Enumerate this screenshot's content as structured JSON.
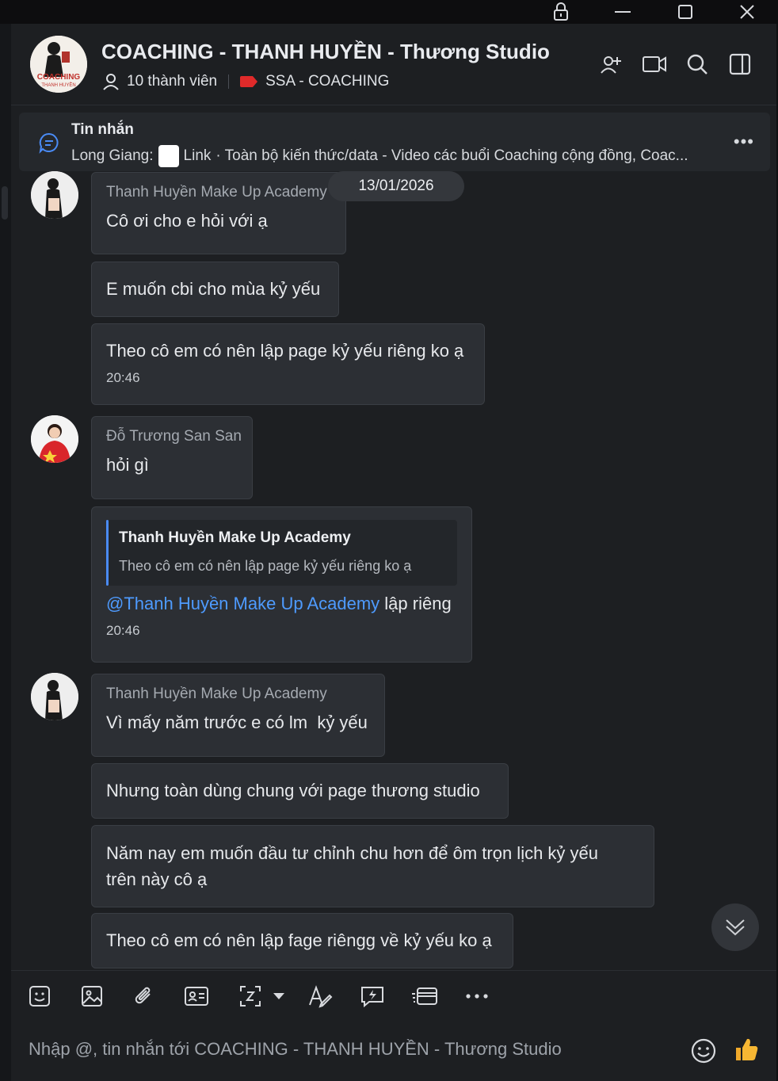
{
  "window": {
    "lock_icon": "lock-icon",
    "minimize_icon": "minimize-icon",
    "maximize_icon": "maximize-icon",
    "close_icon": "close-icon"
  },
  "header": {
    "title": "COACHING - THANH HUYỀN - Thương Studio",
    "members_label": "10 thành viên",
    "tag_label": "SSA - COACHING",
    "tag_color": "#e02a2a",
    "avatar_badge_text": "COACHING",
    "avatar_badge_sub": "THANH HUYỀN",
    "actions": [
      "add-member-icon",
      "video-call-icon",
      "search-icon",
      "sidebar-toggle-icon"
    ]
  },
  "pinned": {
    "title": "Tin nhắn",
    "sender": "Long Giang:",
    "link_label": "Link",
    "text": "· Toàn bộ kiến thức/data - Video các buổi Coaching cộng đồng, Coac..."
  },
  "date_chip": "13/01/2026",
  "messages": [
    {
      "sender": "Thanh Huyền Make Up Academy",
      "text": "Cô ơi cho e hỏi với ạ"
    },
    {
      "text": "E muốn cbi cho mùa kỷ yếu"
    },
    {
      "text": "Theo cô em có nên lập page kỷ yếu riêng ko ạ",
      "time": "20:46"
    },
    {
      "sender": "Đỗ Trương San San",
      "text": "hỏi gì"
    },
    {
      "quote_name": "Thanh Huyền Make Up Academy",
      "quote_text": "Theo cô em có nên lập page kỷ yếu riêng ko ạ",
      "mention": "@Thanh Huyền Make Up Academy",
      "text": " lập riêng",
      "time": "20:46"
    },
    {
      "sender": "Thanh Huyền Make Up Academy",
      "text": "Vì mấy năm trước e có lm  kỷ yếu"
    },
    {
      "text": "Nhưng toàn dùng chung với page thương studio"
    },
    {
      "text_line1": "Năm nay em muốn đầu tư chỉnh chu hơn để ôm trọn lịch kỷ yếu",
      "text_line2": "trên này cô ạ"
    },
    {
      "text": "Theo cô em có nên lập fage riêngg về kỷ yếu ko ạ"
    }
  ],
  "toolbar": [
    "sticker-icon",
    "image-icon",
    "attachment-icon",
    "contact-card-icon",
    "screenshot-icon",
    "format-text-icon",
    "quick-message-icon",
    "card-icon",
    "more-icon"
  ],
  "composer": {
    "placeholder": "Nhập @, tin nhắn tới COACHING - THANH HUYỀN - Thương Studio",
    "emoji_icon": "emoji-icon",
    "like_icon": "thumbs-up-icon"
  },
  "colors": {
    "accent": "#4a8bf5",
    "mention": "#4e9bff",
    "bubble": "#2c2f34",
    "background": "#1d1f22"
  }
}
